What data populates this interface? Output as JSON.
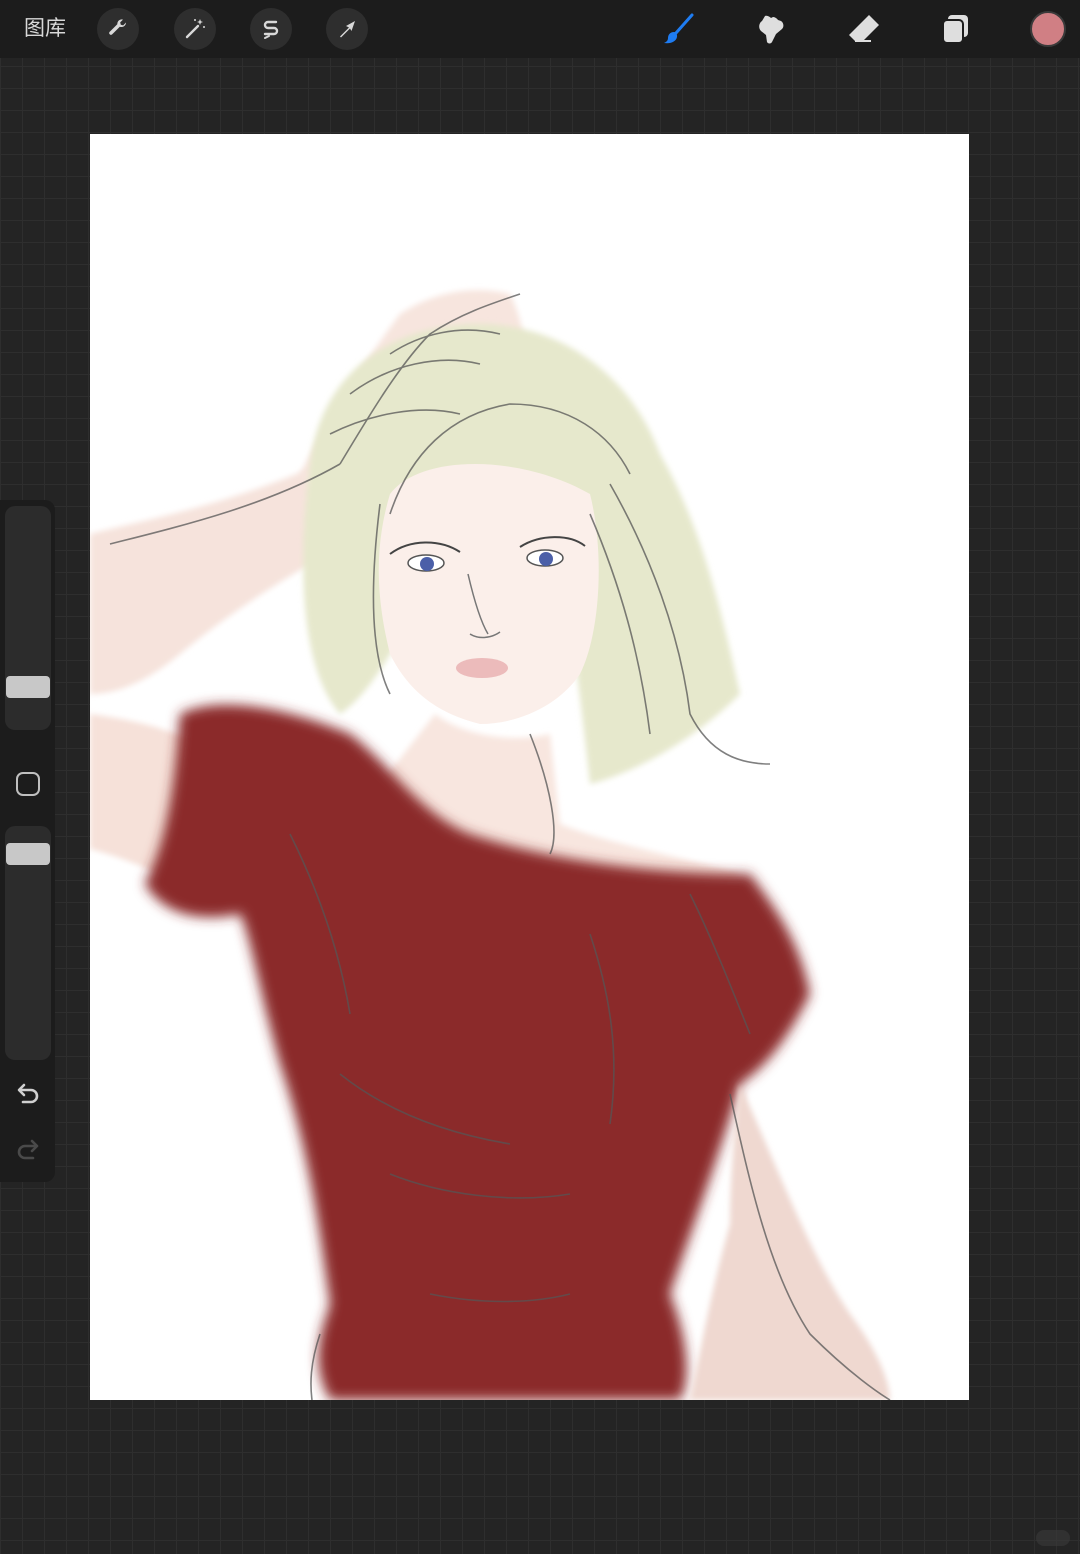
{
  "toolbar": {
    "gallery_label": "图库",
    "left_tools": [
      {
        "name": "actions",
        "icon": "wrench-icon"
      },
      {
        "name": "adjustments",
        "icon": "magic-wand-icon"
      },
      {
        "name": "selection",
        "icon": "selection-s-icon"
      },
      {
        "name": "transform",
        "icon": "arrow-cursor-icon"
      }
    ],
    "right_tools": [
      {
        "name": "brush",
        "icon": "brush-icon",
        "active": true
      },
      {
        "name": "smudge",
        "icon": "smudge-icon"
      },
      {
        "name": "eraser",
        "icon": "eraser-icon"
      },
      {
        "name": "layers",
        "icon": "layers-icon"
      }
    ],
    "current_color": "#d07f84",
    "active_color": "#1e7cf2"
  },
  "sidebar": {
    "brush_size_level": 0.16,
    "opacity_level": 0.92,
    "undo_icon": "undo-icon",
    "redo_icon": "redo-icon"
  },
  "canvas": {
    "artwork": "portrait-sketch",
    "shirt_color": "#8b2a2c",
    "hair_color": "#e3e6c8",
    "skin_color": "#f7e6e0",
    "eye_color": "#4b5fa8"
  }
}
